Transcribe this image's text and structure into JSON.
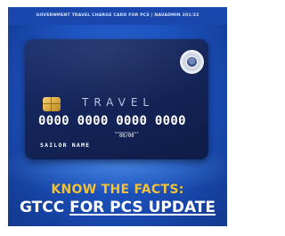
{
  "header": {
    "text": "GOVERNMENT TRAVEL CHARGE CARD FOR PCS | NAVADMIN 201/22"
  },
  "card": {
    "product_label": "TRAVEL",
    "number": "0000 0000 0000 0000",
    "expiry_label": "EXPIRATION DATE",
    "expiry": "00/00",
    "holder_name": "SAILOR NAME",
    "seal_icon": "dod-seal-icon"
  },
  "banner": {
    "headline": "KNOW THE FACTS:",
    "subline_prefix": "GTCC ",
    "subline_underlined": "FOR PCS UPDATE"
  },
  "colors": {
    "background": "#1e55c2",
    "headline": "#f2c23a",
    "card": "#15265c"
  }
}
